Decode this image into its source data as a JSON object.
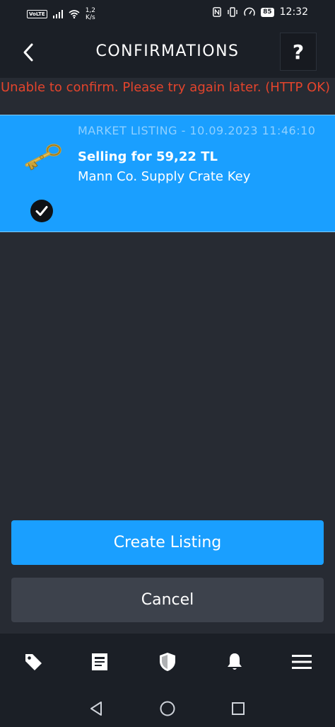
{
  "status_bar": {
    "network_badge": "VoLTE",
    "net_speed_value": "1,2",
    "net_speed_unit": "K/s",
    "battery_level": "85",
    "time": "12:32",
    "icons": [
      "signal-icon",
      "wifi-icon",
      "nfc-icon",
      "vibrate-icon",
      "speedometer-icon",
      "battery-icon"
    ]
  },
  "header": {
    "title": "CONFIRMATIONS",
    "help_label": "?",
    "back_icon": "chevron-left-icon"
  },
  "error_message": "Unable to confirm. Please try again later. (HTTP OK)",
  "confirmation": {
    "header": "MARKET LISTING - 10.09.2023 11:46:10",
    "title": "Selling for 59,22 TL",
    "item_name": "Mann Co. Supply Crate Key",
    "item_icon": "key-icon",
    "selected": true
  },
  "actions": {
    "primary_label": "Create Listing",
    "secondary_label": "Cancel"
  },
  "bottom_nav": [
    "tag-icon",
    "news-icon",
    "shield-icon",
    "bell-icon",
    "menu-icon"
  ],
  "colors": {
    "accent": "#1a9fff",
    "error": "#e4442c",
    "background": "#272b33",
    "bar_background": "#1b1f26"
  }
}
